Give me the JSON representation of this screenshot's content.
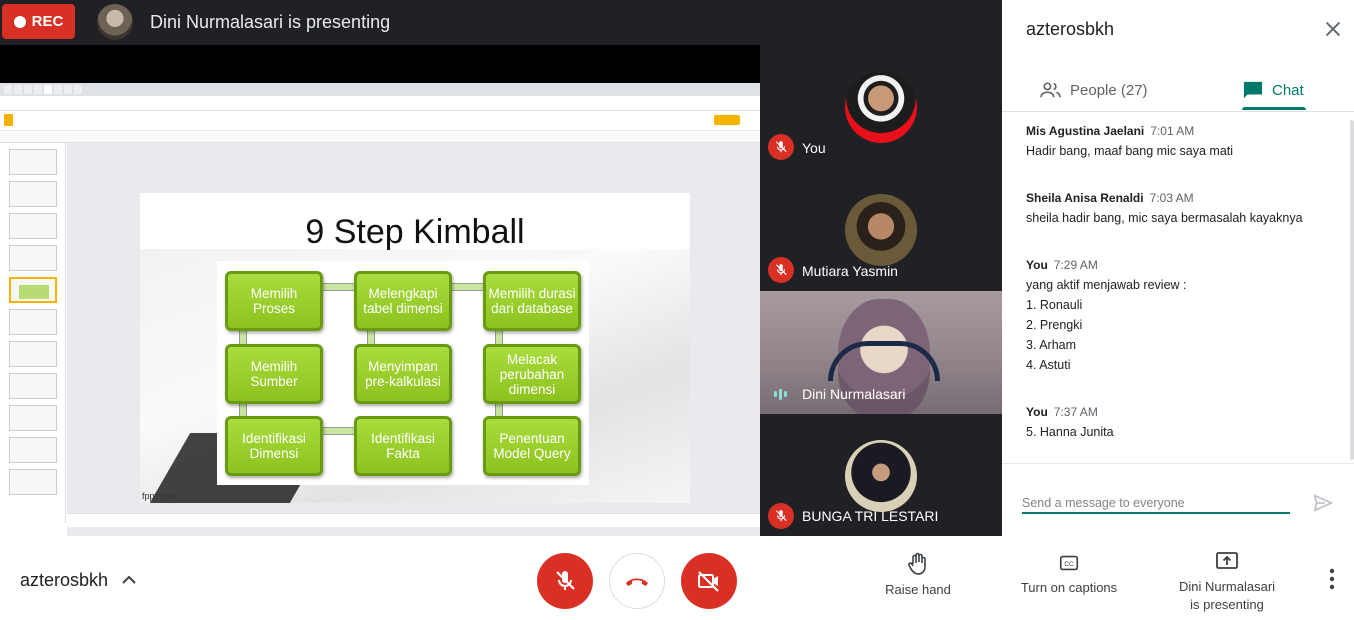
{
  "topbar": {
    "rec_label": "REC",
    "presenter_title": "Dini Nurmalasari is presenting"
  },
  "shared_screen": {
    "slide_title": "9 Step Kimball",
    "steps": [
      "Memilih Proses",
      "Melengkapi tabel dimensi",
      "Memilih durasi dari database",
      "Memilih Sumber",
      "Menyimpan pre-kalkulasi",
      "Melacak perubahan dimensi",
      "Identifikasi Dimensi",
      "Identifikasi Fakta",
      "Penentuan Model Query"
    ],
    "slide_footer": "fppt.com"
  },
  "participants": [
    {
      "name": "You",
      "muted": true
    },
    {
      "name": "Mutiara Yasmin",
      "muted": true
    },
    {
      "name": "Dini Nurmalasari",
      "speaking": true
    },
    {
      "name": "BUNGA TRI LESTARI",
      "muted": true
    }
  ],
  "panel": {
    "title": "azterosbkh",
    "tab_people": "People (27)",
    "tab_chat": "Chat",
    "messages": [
      {
        "sender": "Mis Agustina Jaelani",
        "time": "7:01 AM",
        "lines": [
          "Hadir bang, maaf bang mic saya mati"
        ]
      },
      {
        "sender": "Sheila Anisa Renaldi",
        "time": "7:03 AM",
        "lines": [
          "sheila hadir bang, mic saya bermasalah kayaknya"
        ]
      },
      {
        "sender": "You",
        "time": "7:29 AM",
        "lines": [
          "yang aktif menjawab review :",
          "1. Ronauli",
          "2. Prengki",
          "3. Arham",
          "4. Astuti"
        ]
      },
      {
        "sender": "You",
        "time": "7:37 AM",
        "lines": [
          "5. Hanna Junita"
        ]
      }
    ],
    "input_placeholder": "Send a message to everyone"
  },
  "bottombar": {
    "meeting_name": "azterosbkh",
    "raise_hand": "Raise hand",
    "captions": "Turn on captions",
    "presenting_line1": "Dini Nurmalasari",
    "presenting_line2": "is presenting"
  },
  "colors": {
    "rec_red": "#d93025",
    "accent_teal": "#00796b",
    "step_green": "#8cc21e"
  }
}
